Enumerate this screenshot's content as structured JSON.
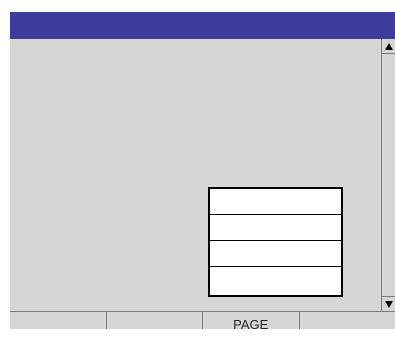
{
  "colors": {
    "titlebar": "#3d3d9c",
    "background": "#d6d6d6"
  },
  "titlebar": {
    "title": ""
  },
  "scrollbar": {
    "up_icon": "triangle-up-icon",
    "down_icon": "triangle-down-icon"
  },
  "popup": {
    "rows": [
      {
        "label": ""
      },
      {
        "label": ""
      },
      {
        "label": ""
      },
      {
        "label": ""
      }
    ]
  },
  "softkeys": [
    {
      "label": ""
    },
    {
      "label": ""
    },
    {
      "label": "PAGE"
    },
    {
      "label": ""
    }
  ]
}
